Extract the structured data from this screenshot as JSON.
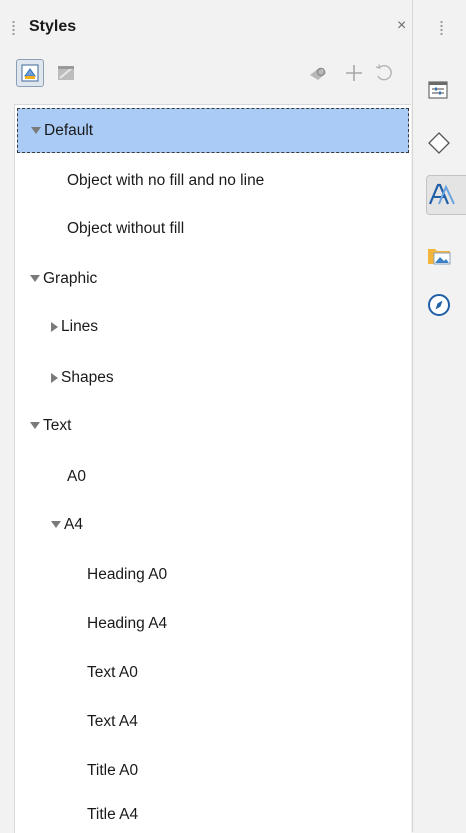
{
  "panel": {
    "title": "Styles",
    "close_glyph": "×"
  },
  "toolbar": {
    "left_buttons": [
      "style-list-icon",
      "fill-format-icon"
    ],
    "right_buttons": [
      "new-style-from-selection-icon",
      "new-style-icon",
      "update-style-icon"
    ]
  },
  "tree": {
    "rows": [
      {
        "label": "Default",
        "expander": "down",
        "level": 0,
        "selected": true
      },
      {
        "label": "Object with no fill and no line",
        "expander": "none",
        "level": 1
      },
      {
        "label": "Object without fill",
        "expander": "none",
        "level": 1
      },
      {
        "label": "Graphic",
        "expander": "down",
        "level": 0
      },
      {
        "label": "Lines",
        "expander": "right",
        "level": 1
      },
      {
        "label": "Shapes",
        "expander": "right",
        "level": 1
      },
      {
        "label": "Text",
        "expander": "down",
        "level": 0
      },
      {
        "label": "A0",
        "expander": "none",
        "level": 1
      },
      {
        "label": "A4",
        "expander": "down",
        "level": 1
      },
      {
        "label": "Heading A0",
        "expander": "none",
        "level": 2
      },
      {
        "label": "Heading A4",
        "expander": "none",
        "level": 2
      },
      {
        "label": "Text A0",
        "expander": "none",
        "level": 2
      },
      {
        "label": "Text A4",
        "expander": "none",
        "level": 2
      },
      {
        "label": "Title A0",
        "expander": "none",
        "level": 2
      },
      {
        "label": "Title A4",
        "expander": "none",
        "level": 2
      }
    ]
  },
  "deck": {
    "tabs": [
      "properties-icon",
      "shapes-icon",
      "styles-icon",
      "gallery-icon",
      "navigator-icon"
    ],
    "active_tab": "styles-icon"
  },
  "colors": {
    "selection": "#a9cbf5",
    "accent": "#2f6fb5"
  }
}
